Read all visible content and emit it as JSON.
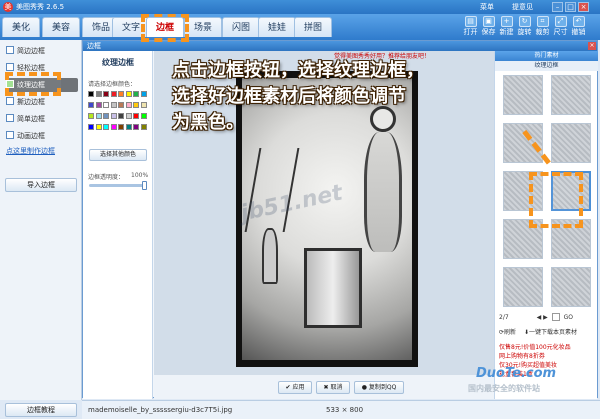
{
  "window": {
    "title": "美图秀秀 2.6.5",
    "menu_label": "菜单",
    "feedback_label": "提意见"
  },
  "tabs": [
    {
      "label": "美化",
      "active": false
    },
    {
      "label": "美容",
      "active": false
    },
    {
      "label": "饰品",
      "active": false
    },
    {
      "label": "文字",
      "active": false
    },
    {
      "label": "边框",
      "active": true
    },
    {
      "label": "场景",
      "active": false
    },
    {
      "label": "闪图",
      "active": false
    },
    {
      "label": "娃娃",
      "active": false
    },
    {
      "label": "拼图",
      "active": false
    }
  ],
  "toolbar": [
    {
      "label": "打开",
      "icon": "folder-icon"
    },
    {
      "label": "保存",
      "icon": "save-icon"
    },
    {
      "label": "新建",
      "icon": "new-icon"
    },
    {
      "label": "旋转",
      "icon": "rotate-icon"
    },
    {
      "label": "裁剪",
      "icon": "crop-icon"
    },
    {
      "label": "尺寸",
      "icon": "resize-icon"
    },
    {
      "label": "撤销",
      "icon": "undo-icon"
    }
  ],
  "sidebar": {
    "items": [
      {
        "label": "简边边框",
        "active": false
      },
      {
        "label": "轻松边框",
        "active": false
      },
      {
        "label": "纹理边框",
        "active": true
      },
      {
        "label": "撕边边框",
        "active": false
      },
      {
        "label": "简单边框",
        "active": false
      },
      {
        "label": "动画边框",
        "active": false
      }
    ],
    "link": "点这里制作边框",
    "import_button": "导入边框",
    "tutorial_button": "边框教程"
  },
  "dialog": {
    "title": "边框",
    "close": "×"
  },
  "controls": {
    "title": "纹理边框",
    "color_label": "请选择边框颜色：",
    "more_colors": "选择其他颜色",
    "opacity_label": "边框透明度：",
    "opacity_value": "100%",
    "opacity_fraction": 1.0
  },
  "swatch_colors": [
    "#000000",
    "#7f7f7f",
    "#880015",
    "#ed1c24",
    "#ff7f27",
    "#fff200",
    "#22b14c",
    "#00a2e8",
    "#3f48cc",
    "#a349a4",
    "#ffffff",
    "#c3c3c3",
    "#b97a57",
    "#ffaec9",
    "#ffc90e",
    "#efe4b0",
    "#b5e61d",
    "#99d9ea",
    "#7092be",
    "#c8bfe7",
    "#404040",
    "#d0d0d0",
    "#ff0000",
    "#00ff00",
    "#0000ff",
    "#ffff00",
    "#00ffff",
    "#ff00ff",
    "#804000",
    "#008080",
    "#800080",
    "#808000"
  ],
  "canvas": {
    "promo": "觉得美图秀秀好用？推荐给朋友吧！"
  },
  "gallery": {
    "header": "热门素材",
    "subheader": "纹理边框",
    "pager": {
      "current": "2/7",
      "go": "GO"
    },
    "refresh": "刷新",
    "download_more": "一键下载本页素材",
    "ads": [
      "仅售8元!价值100元化妆品",
      "网上购物有8折券",
      "仅30元!购买超值美妆",
      "礼盒套装1盒"
    ]
  },
  "buttons": {
    "apply": "应用",
    "cancel": "取消",
    "copy_to_qq": "复制到QQ"
  },
  "status": {
    "filename": "mademoiselle_by_sssssergiu-d3c7T5i.jpg",
    "dimensions": "533 × 800"
  },
  "instruction": "点击边框按钮，选择纹理边框，\n选择好边框素材后将颜色调节\n为黑色。",
  "watermark": "jb51.net",
  "corner_watermark": "国内最安全的软件站",
  "corner_brand": "DuoTe.com",
  "accent": {
    "highlight": "#f7941d",
    "tab_bar": "#2f7bcc"
  }
}
